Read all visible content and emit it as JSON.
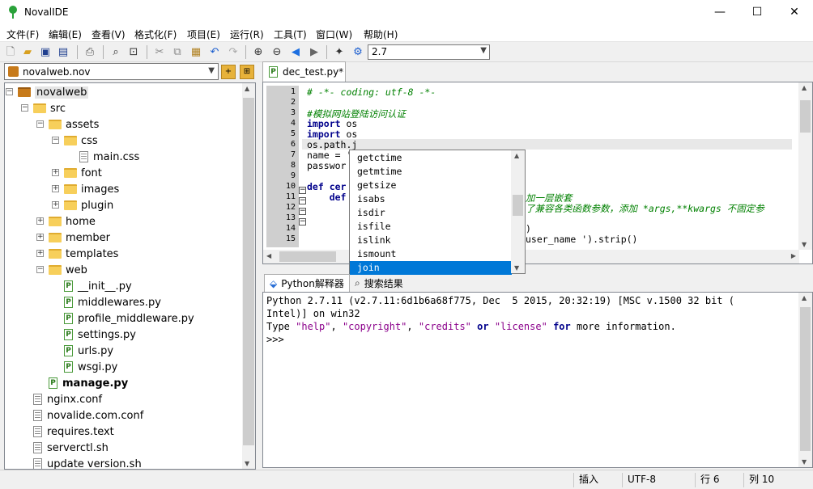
{
  "app": {
    "title": "NovalIDE"
  },
  "window_controls": {
    "minimize": "—",
    "maximize": "☐",
    "close": "✕"
  },
  "menu": [
    "文件(F)",
    "编辑(E)",
    "查看(V)",
    "格式化(F)",
    "项目(E)",
    "运行(R)",
    "工具(T)",
    "窗口(W)",
    "帮助(H)"
  ],
  "toolbar": {
    "interpreter_version": "2.7"
  },
  "project": {
    "combo_value": "novalweb.nov",
    "tree": [
      {
        "label": "novalweb",
        "depth": 0,
        "kind": "project",
        "expander": "-"
      },
      {
        "label": "src",
        "depth": 1,
        "kind": "folder",
        "expander": "-"
      },
      {
        "label": "assets",
        "depth": 2,
        "kind": "folder",
        "expander": "-"
      },
      {
        "label": "css",
        "depth": 3,
        "kind": "folder",
        "expander": "-"
      },
      {
        "label": "main.css",
        "depth": 4,
        "kind": "css",
        "expander": ""
      },
      {
        "label": "font",
        "depth": 3,
        "kind": "folder",
        "expander": "+"
      },
      {
        "label": "images",
        "depth": 3,
        "kind": "folder",
        "expander": "+"
      },
      {
        "label": "plugin",
        "depth": 3,
        "kind": "folder",
        "expander": "+"
      },
      {
        "label": "home",
        "depth": 2,
        "kind": "folder",
        "expander": "+"
      },
      {
        "label": "member",
        "depth": 2,
        "kind": "folder",
        "expander": "+"
      },
      {
        "label": "templates",
        "depth": 2,
        "kind": "folder",
        "expander": "+"
      },
      {
        "label": "web",
        "depth": 2,
        "kind": "folder",
        "expander": "-"
      },
      {
        "label": "__init__.py",
        "depth": 3,
        "kind": "py",
        "expander": ""
      },
      {
        "label": "middlewares.py",
        "depth": 3,
        "kind": "py",
        "expander": ""
      },
      {
        "label": "profile_middleware.py",
        "depth": 3,
        "kind": "py",
        "expander": ""
      },
      {
        "label": "settings.py",
        "depth": 3,
        "kind": "py",
        "expander": ""
      },
      {
        "label": "urls.py",
        "depth": 3,
        "kind": "py",
        "expander": ""
      },
      {
        "label": "wsgi.py",
        "depth": 3,
        "kind": "py",
        "expander": ""
      },
      {
        "label": "manage.py",
        "depth": 2,
        "kind": "py",
        "expander": "",
        "bold": true
      },
      {
        "label": "nginx.conf",
        "depth": 1,
        "kind": "txt",
        "expander": ""
      },
      {
        "label": "novalide.com.conf",
        "depth": 1,
        "kind": "txt",
        "expander": ""
      },
      {
        "label": "requires.text",
        "depth": 1,
        "kind": "txt",
        "expander": ""
      },
      {
        "label": "serverctl.sh",
        "depth": 1,
        "kind": "txt",
        "expander": ""
      },
      {
        "label": "update version.sh",
        "depth": 1,
        "kind": "txt",
        "expander": ""
      }
    ]
  },
  "editor": {
    "tab_label": "dec_test.py*",
    "line_numbers": [
      "1",
      "2",
      "3",
      "4",
      "5",
      "6",
      "7",
      "8",
      "9",
      "10",
      "11",
      "12",
      "13",
      "14",
      "15"
    ],
    "lines": [
      {
        "parts": [
          {
            "t": "# -*- coding: utf-8 -*-",
            "c": "cm"
          }
        ]
      },
      {
        "parts": []
      },
      {
        "parts": [
          {
            "t": "#模拟网站登陆访问认证",
            "c": "cm"
          }
        ]
      },
      {
        "parts": [
          {
            "t": "import",
            "c": "kw"
          },
          {
            "t": " os",
            "c": ""
          }
        ]
      },
      {
        "parts": [
          {
            "t": "import",
            "c": "kw"
          },
          {
            "t": " os",
            "c": ""
          }
        ]
      },
      {
        "parts": [
          {
            "t": "os.path.j",
            "c": ""
          }
        ]
      },
      {
        "parts": [
          {
            "t": "name = '",
            "c": ""
          }
        ]
      },
      {
        "parts": [
          {
            "t": "passwor",
            "c": ""
          }
        ]
      },
      {
        "parts": []
      },
      {
        "parts": [
          {
            "t": "def",
            "c": "kw"
          },
          {
            "t": " cer",
            "c": "kw"
          }
        ]
      },
      {
        "parts": [
          {
            "t": "    def",
            "c": "kw"
          }
        ]
      },
      {
        "parts": []
      },
      {
        "parts": []
      },
      {
        "parts": []
      },
      {
        "parts": []
      }
    ],
    "right_fragments": [
      {
        "text": "加一层嵌套",
        "c": "cm"
      },
      {
        "text": "了兼容各类函数参数，添加 *args,**kwargs 不固定参",
        "c": "cm"
      },
      {
        "text": ")",
        "c": ""
      },
      {
        "text": "user_name ').strip()",
        "c": ""
      }
    ]
  },
  "autocomplete": {
    "items": [
      "getctime",
      "getmtime",
      "getsize",
      "isabs",
      "isdir",
      "isfile",
      "islink",
      "ismount",
      "join"
    ],
    "selected": "join"
  },
  "bottom_tabs": {
    "interpreter": "Python解释器",
    "search": "搜索结果"
  },
  "console": {
    "banner_line1": "Python 2.7.11 (v2.7.11:6d1b6a68f775, Dec  5 2015, 20:32:19) [MSC v.1500 32 bit (",
    "banner_line2": "Intel)] on win32",
    "type_word": "Type ",
    "help": "\"help\"",
    "comma1": ", ",
    "copyright": "\"copyright\"",
    "comma2": ", ",
    "credits": "\"credits\"",
    "or_word": " or ",
    "license": "\"license\"",
    "for_word": " for",
    "rest": " more information.",
    "prompt": ">>>"
  },
  "status": {
    "mode": "插入",
    "encoding": "UTF-8",
    "line": "行 6",
    "column": "列 10"
  }
}
